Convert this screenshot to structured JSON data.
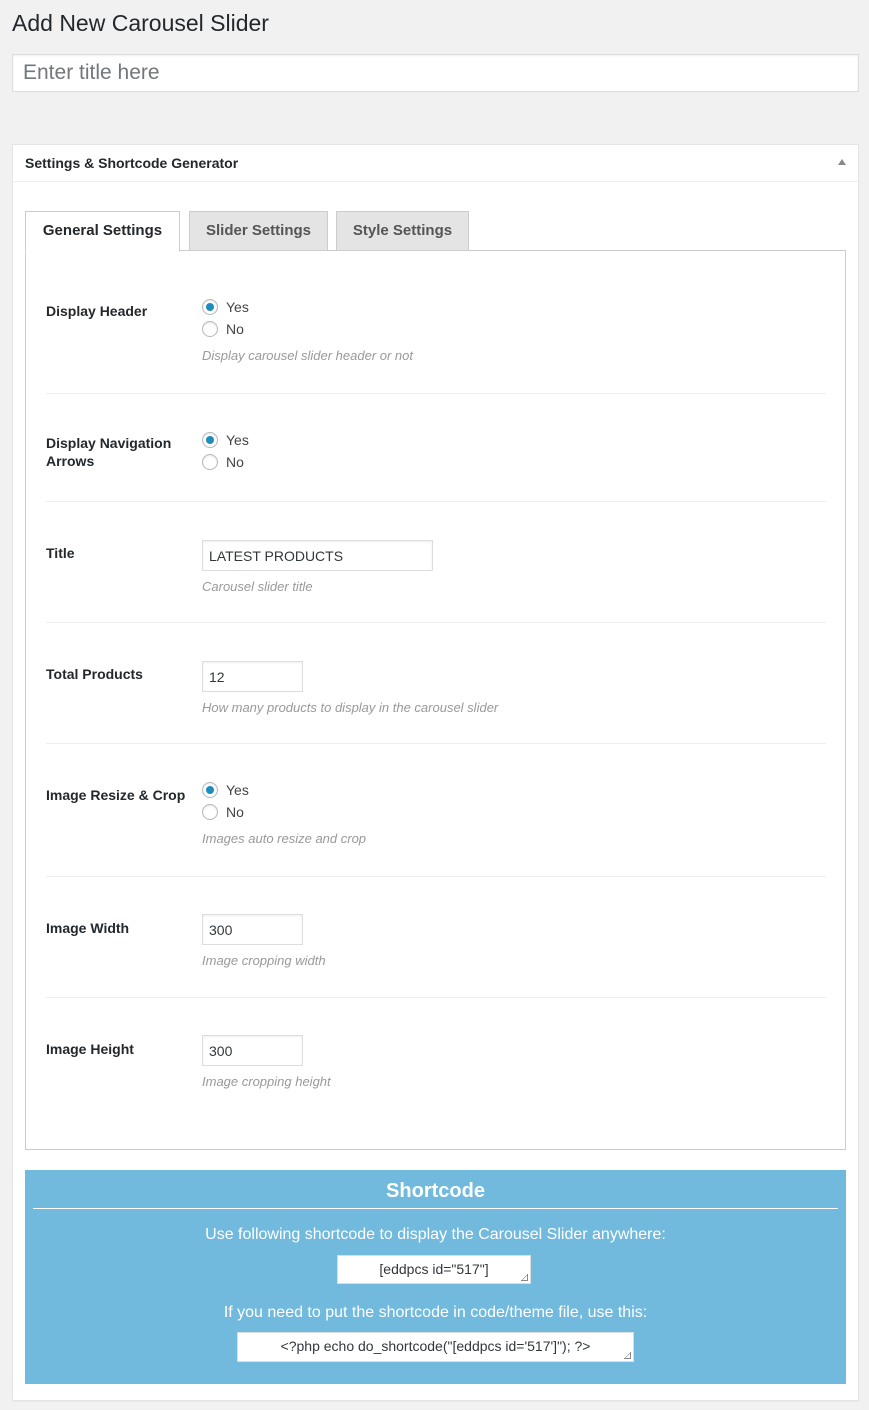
{
  "page": {
    "title": "Add New Carousel Slider"
  },
  "title_field": {
    "placeholder": "Enter title here",
    "value": ""
  },
  "metabox": {
    "title": "Settings & Shortcode Generator"
  },
  "tabs": [
    {
      "label": "General Settings",
      "active": true
    },
    {
      "label": "Slider Settings",
      "active": false
    },
    {
      "label": "Style Settings",
      "active": false
    }
  ],
  "settings": {
    "display_header": {
      "label": "Display Header",
      "options": [
        "Yes",
        "No"
      ],
      "selected": "Yes",
      "description": "Display carousel slider header or not"
    },
    "display_navigation": {
      "label": "Display Navigation Arrows",
      "options": [
        "Yes",
        "No"
      ],
      "selected": "Yes"
    },
    "title": {
      "label": "Title",
      "value": "LATEST PRODUCTS",
      "description": "Carousel slider title"
    },
    "total_products": {
      "label": "Total Products",
      "value": "12",
      "description": "How many products to display in the carousel slider"
    },
    "image_resize": {
      "label": "Image Resize & Crop",
      "options": [
        "Yes",
        "No"
      ],
      "selected": "Yes",
      "description": "Images auto resize and crop"
    },
    "image_width": {
      "label": "Image Width",
      "value": "300",
      "description": "Image cropping width"
    },
    "image_height": {
      "label": "Image Height",
      "value": "300",
      "description": "Image cropping height"
    }
  },
  "shortcode": {
    "heading": "Shortcode",
    "instruction": "Use following shortcode to display the Carousel Slider anywhere:",
    "code": "[eddpcs id=\"517\"]",
    "php_instruction": "If you need to put the shortcode in code/theme file, use this:",
    "php_code": "<?php echo do_shortcode(\"[eddpcs id='517']\"); ?>"
  },
  "colors": {
    "shortcode_bg": "#71b9dd",
    "radio_accent": "#1e8cbe",
    "page_bg": "#f1f1f1"
  }
}
